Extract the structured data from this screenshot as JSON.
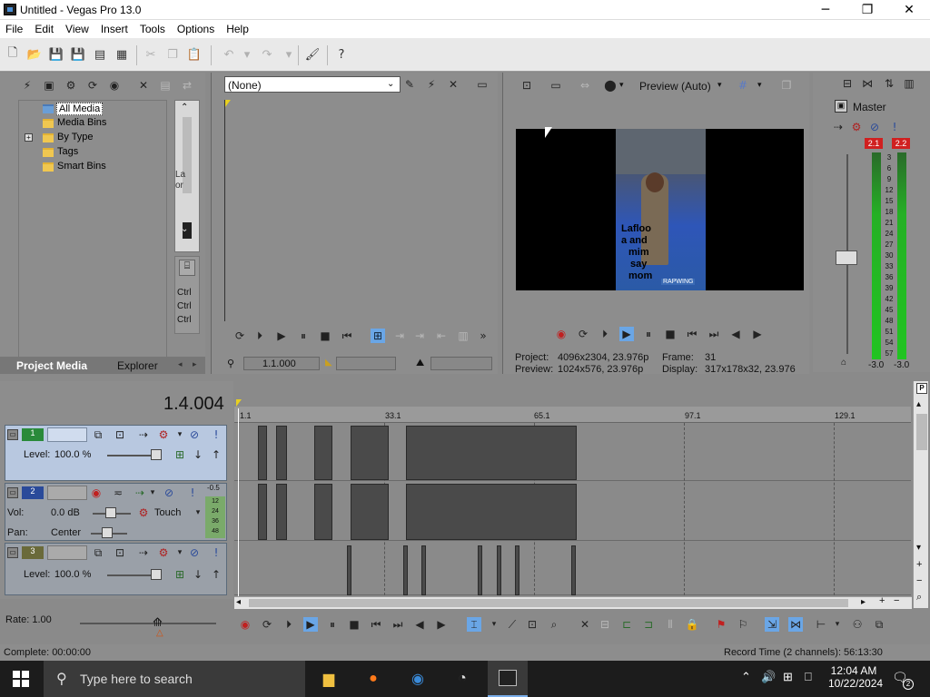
{
  "window": {
    "title": "Untitled - Vegas Pro 13.0"
  },
  "menu": [
    "File",
    "Edit",
    "View",
    "Insert",
    "Tools",
    "Options",
    "Help"
  ],
  "explorer": {
    "items": [
      "All Media",
      "Media Bins",
      "By Type",
      "Tags",
      "Smart Bins"
    ],
    "tabs": [
      "Project Media",
      "Explorer"
    ],
    "side_text": [
      "La",
      "or"
    ],
    "ctrl_lines": [
      "Ctrl",
      "Ctrl",
      "Ctrl"
    ]
  },
  "trimmer": {
    "dropdown": "(None)",
    "time": "1.1.000"
  },
  "preview": {
    "mode": "Preview (Auto)",
    "caption_lines": [
      "Lafloo",
      "a and",
      "mim",
      "say",
      "mom"
    ],
    "watermark": "RAPWING",
    "project_label": "Project:",
    "project_value": "4096x2304, 23.976p",
    "preview_label": "Preview:",
    "preview_value": "1024x576, 23.976p",
    "frame_label": "Frame:",
    "frame_value": "31",
    "display_label": "Display:",
    "display_value": "317x178x32, 23.976"
  },
  "master": {
    "title": "Master",
    "peak_left": "2.1",
    "peak_right": "2.2",
    "scale": [
      "3",
      "6",
      "9",
      "12",
      "15",
      "18",
      "21",
      "24",
      "27",
      "30",
      "33",
      "36",
      "39",
      "42",
      "45",
      "48",
      "51",
      "54",
      "57"
    ],
    "bottom_left": "-3.0",
    "bottom_right": "-3.0"
  },
  "timeline": {
    "timecode": "1.4.004",
    "ruler": [
      "1.1",
      "33.1",
      "65.1",
      "97.1",
      "129.1"
    ],
    "tracks": [
      {
        "num": "1",
        "level_label": "Level:",
        "level": "100.0 %"
      },
      {
        "num": "2",
        "vol_label": "Vol:",
        "vol": "0.0 dB",
        "pan_label": "Pan:",
        "pan": "Center",
        "touch": "Touch",
        "meter": [
          "-0.5",
          "12",
          "24",
          "36",
          "48"
        ]
      },
      {
        "num": "3",
        "level_label": "Level:",
        "level": "100.0 %"
      }
    ],
    "rate": "Rate: 1.00"
  },
  "status": {
    "left": "Complete: 00:00:00",
    "right": "Record Time (2 channels): 56:13:30"
  },
  "taskbar": {
    "search_placeholder": "Type here to search",
    "time": "12:04 AM",
    "date": "10/22/2024",
    "notifications": "2"
  }
}
